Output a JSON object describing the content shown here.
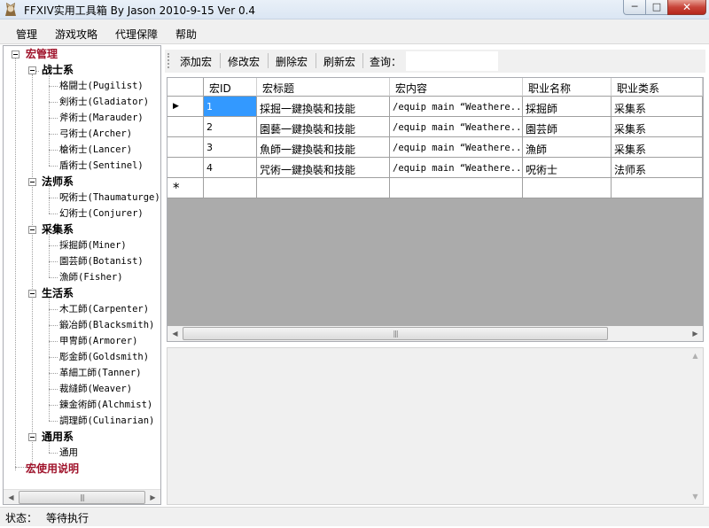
{
  "window": {
    "title": "FFXIV实用工具箱 By Jason 2010-9-15 Ver 0.4"
  },
  "menu": [
    "管理",
    "游戏攻略",
    "代理保障",
    "帮助"
  ],
  "tree": {
    "root": "宏管理",
    "categories": [
      {
        "label": "战士系",
        "children": [
          "格闘士(Pugilist)",
          "剣術士(Gladiator)",
          "斧術士(Marauder)",
          "弓術士(Archer)",
          "槍術士(Lancer)",
          "盾術士(Sentinel)"
        ]
      },
      {
        "label": "法师系",
        "children": [
          "呪術士(Thaumaturge)",
          "幻術士(Conjurer)"
        ]
      },
      {
        "label": "采集系",
        "children": [
          "採掘師(Miner)",
          "園芸師(Botanist)",
          "漁師(Fisher)"
        ]
      },
      {
        "label": "生活系",
        "children": [
          "木工師(Carpenter)",
          "鍛冶師(Blacksmith)",
          "甲冑師(Armorer)",
          "彫金師(Goldsmith)",
          "革細工師(Tanner)",
          "裁縫師(Weaver)",
          "錬金術師(Alchmist)",
          "調理師(Culinarian)"
        ]
      },
      {
        "label": "通用系",
        "children": [
          "通用"
        ]
      }
    ],
    "root2": "宏使用说明"
  },
  "toolbar": {
    "add": "添加宏",
    "edit": "修改宏",
    "delete": "删除宏",
    "refresh": "刷新宏",
    "query_label": "查询：",
    "query_value": ""
  },
  "grid": {
    "columns": [
      "宏ID",
      "宏标题",
      "宏内容",
      "职业名称",
      "职业类系"
    ],
    "rows": [
      [
        "1",
        "採掘一鍵換裝和技能",
        "/equip main “Weathere...",
        "採掘師",
        "采集系"
      ],
      [
        "2",
        "園藝一鍵換裝和技能",
        "/equip main “Weathere...",
        "園芸師",
        "采集系"
      ],
      [
        "3",
        "魚師一鍵換裝和技能",
        "/equip main “Weathere...",
        "漁師",
        "采集系"
      ],
      [
        "4",
        "咒術一鍵換裝和技能",
        "/equip main “Weathere...",
        "呪術士",
        "法师系"
      ]
    ],
    "current_row_marker": "▶",
    "new_row_marker": "*"
  },
  "status": {
    "label": "状态：",
    "value": "等待执行"
  }
}
